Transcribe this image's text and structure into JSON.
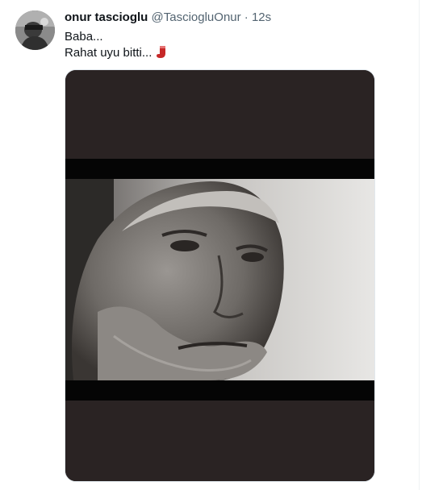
{
  "tweet": {
    "author": {
      "display_name": "onur tascioglu",
      "handle": "@TasciogluOnur",
      "separator": "·",
      "time": "12s"
    },
    "lines": [
      "Baba...",
      "Rahat uyu bitti..."
    ],
    "emoji": "red-stocking",
    "media": {
      "kind": "video-still",
      "description_icon": "elderly-man-photo"
    }
  },
  "colors": {
    "text_primary": "#0f1419",
    "text_secondary": "#536471",
    "media_background": "#2a2323",
    "emoji_red": "#c62828"
  }
}
